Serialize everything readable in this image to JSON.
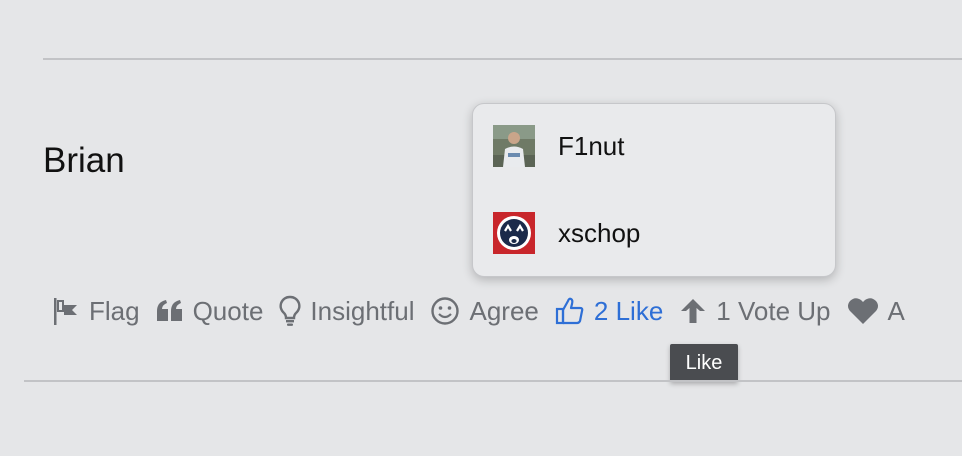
{
  "post": {
    "author": "Brian"
  },
  "reactions_popover": {
    "users": [
      {
        "name": "F1nut",
        "avatar": "photo-avatar"
      },
      {
        "name": "xschop",
        "avatar": "face-logo-avatar"
      }
    ]
  },
  "actions": {
    "flag": {
      "label": "Flag",
      "icon": "flag-icon"
    },
    "quote": {
      "label": "Quote",
      "icon": "quote-icon"
    },
    "insightful": {
      "label": "Insightful",
      "icon": "lightbulb-icon"
    },
    "agree": {
      "label": "Agree",
      "icon": "smiley-icon"
    },
    "like": {
      "count": "2",
      "label": "Like",
      "icon": "thumbs-up-icon",
      "color": "#2e6fd6"
    },
    "vote_up": {
      "count": "1",
      "label": "Vote Up",
      "icon": "arrow-up-icon"
    },
    "awesome": {
      "label": "A",
      "icon": "heart-icon"
    }
  },
  "tooltip": {
    "text": "Like"
  },
  "colors": {
    "background": "#e5e6e8",
    "text_muted": "#6c6f74",
    "accent": "#2e6fd6"
  }
}
